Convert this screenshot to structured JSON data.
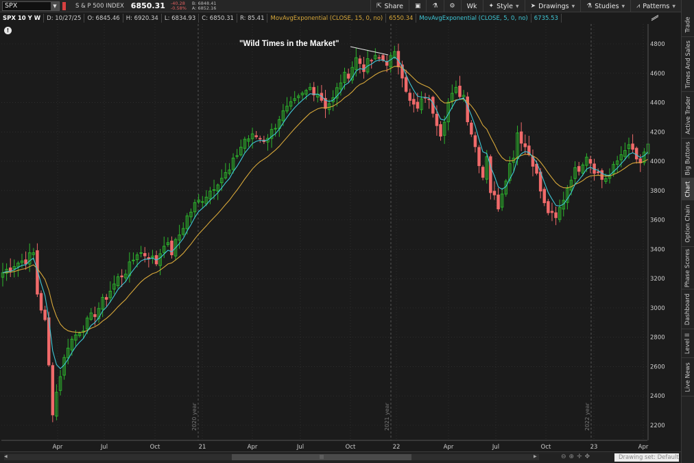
{
  "toolbar": {
    "symbol": "SPX",
    "index_name": "S & P 500 INDEX",
    "price": "6850.31",
    "change": "-40.28",
    "change_pct": "-0.58%",
    "bid": "B: 6848.41",
    "ask": "A: 6852.16",
    "buttons": {
      "share": "Share",
      "timeframe": "Wk",
      "style": "Style",
      "drawings": "Drawings",
      "studies": "Studies",
      "patterns": "Patterns"
    }
  },
  "inforow": {
    "title": "SPX 10 Y W",
    "date": "D: 10/27/25",
    "open": "O: 6845.46",
    "high": "H: 6920.34",
    "low": "L: 6834.93",
    "close": "C: 6850.31",
    "range": "R: 85.41",
    "ema15_label": "MovAvgExponential (CLOSE, 15, 0, no)",
    "ema15_value": "6550.34",
    "ema5_label": "MovAvgExponential (CLOSE, 5, 0, no)",
    "ema5_value": "6735.53"
  },
  "colors": {
    "background": "#1b1b1b",
    "up_candle": "#2db82d",
    "down_candle": "#f06a6a",
    "ema15": "#d8a83a",
    "ema5": "#3fc9d8",
    "grid": "#3a3a3a"
  },
  "annotation": "\"Wild Times in the Market\"",
  "year_markers": [
    "2020 year",
    "2021 year",
    "2022 year"
  ],
  "side_tabs": [
    "Trade",
    "Times And Sales",
    "Active Trader",
    "Big Buttons",
    "Chart",
    "Option Chain",
    "Phase Scores",
    "Dashboard",
    "Level II",
    "Live News"
  ],
  "active_side_tab": "Chart",
  "drawing_set": "Drawing set: Default",
  "chart_data": {
    "type": "candlestick",
    "y_ticks": [
      2200,
      2400,
      2600,
      2800,
      3000,
      3200,
      3400,
      3600,
      3800,
      4000,
      4200,
      4400,
      4600,
      4800
    ],
    "ylim": [
      2100,
      4900
    ],
    "x_ticks": [
      "Apr",
      "Jul",
      "Oct",
      "21",
      "Apr",
      "Jul",
      "Oct",
      "22",
      "Apr",
      "Jul",
      "Oct",
      "23",
      "Apr"
    ],
    "grid": true,
    "candle_count": 169,
    "anchors": [
      [
        0,
        3240
      ],
      [
        3,
        3300
      ],
      [
        6,
        3330
      ],
      [
        8,
        3370
      ],
      [
        9,
        3100
      ],
      [
        11,
        2900
      ],
      [
        13,
        2300
      ],
      [
        15,
        2550
      ],
      [
        17,
        2750
      ],
      [
        20,
        2850
      ],
      [
        22,
        2900
      ],
      [
        25,
        3000
      ],
      [
        28,
        3120
      ],
      [
        30,
        3200
      ],
      [
        33,
        3280
      ],
      [
        35,
        3380
      ],
      [
        38,
        3360
      ],
      [
        40,
        3310
      ],
      [
        42,
        3450
      ],
      [
        44,
        3380
      ],
      [
        46,
        3500
      ],
      [
        48,
        3620
      ],
      [
        50,
        3700
      ],
      [
        52,
        3750
      ],
      [
        54,
        3800
      ],
      [
        56,
        3870
      ],
      [
        59,
        3930
      ],
      [
        61,
        4050
      ],
      [
        63,
        4150
      ],
      [
        66,
        4170
      ],
      [
        68,
        4150
      ],
      [
        70,
        4200
      ],
      [
        72,
        4300
      ],
      [
        74,
        4350
      ],
      [
        77,
        4420
      ],
      [
        80,
        4500
      ],
      [
        82,
        4470
      ],
      [
        84,
        4380
      ],
      [
        86,
        4420
      ],
      [
        88,
        4550
      ],
      [
        90,
        4600
      ],
      [
        92,
        4700
      ],
      [
        94,
        4640
      ],
      [
        96,
        4690
      ],
      [
        98,
        4700
      ],
      [
        100,
        4680
      ],
      [
        102,
        4720
      ],
      [
        104,
        4600
      ],
      [
        106,
        4400
      ],
      [
        108,
        4350
      ],
      [
        110,
        4450
      ],
      [
        112,
        4350
      ],
      [
        114,
        4200
      ],
      [
        116,
        4400
      ],
      [
        118,
        4480
      ],
      [
        120,
        4450
      ],
      [
        121,
        4300
      ],
      [
        123,
        4100
      ],
      [
        125,
        3900
      ],
      [
        126,
        4050
      ],
      [
        127,
        3800
      ],
      [
        129,
        3700
      ],
      [
        131,
        3900
      ],
      [
        133,
        4050
      ],
      [
        134,
        4200
      ],
      [
        136,
        4100
      ],
      [
        138,
        4000
      ],
      [
        139,
        3900
      ],
      [
        141,
        3700
      ],
      [
        143,
        3620
      ],
      [
        144,
        3600
      ],
      [
        146,
        3750
      ],
      [
        148,
        3900
      ],
      [
        150,
        3960
      ],
      [
        152,
        4050
      ],
      [
        154,
        3950
      ],
      [
        156,
        3880
      ],
      [
        158,
        3900
      ],
      [
        160,
        4000
      ],
      [
        162,
        4100
      ],
      [
        164,
        4070
      ],
      [
        166,
        3960
      ],
      [
        167,
        4050
      ],
      [
        168,
        4120
      ]
    ],
    "ema15_current": 6550.34,
    "ema5_current": 6735.53
  }
}
